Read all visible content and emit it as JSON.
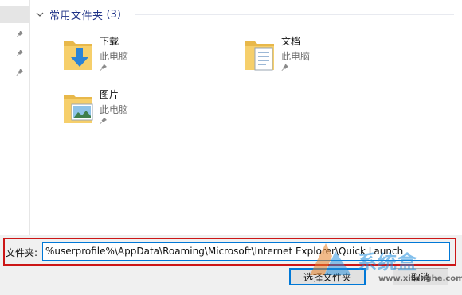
{
  "section": {
    "title": "常用文件夹",
    "count": "(3)"
  },
  "items": [
    {
      "name": "下载",
      "location": "此电脑",
      "icon": "downloads-folder-icon"
    },
    {
      "name": "文档",
      "location": "此电脑",
      "icon": "documents-folder-icon"
    },
    {
      "name": "图片",
      "location": "此电脑",
      "icon": "pictures-folder-icon"
    }
  ],
  "folder_field": {
    "label": "文件夹:",
    "value": "%userprofile%\\AppData\\Roaming\\Microsoft\\Internet Explorer\\Quick Launch"
  },
  "buttons": {
    "select_folder": "选择文件夹",
    "cancel": "取消"
  },
  "watermark": {
    "text": "系统盒",
    "url": "www.xitonghe.com"
  },
  "colors": {
    "section_title": "#1e3287",
    "highlight_border": "#cc1616",
    "accent": "#0078d7"
  }
}
